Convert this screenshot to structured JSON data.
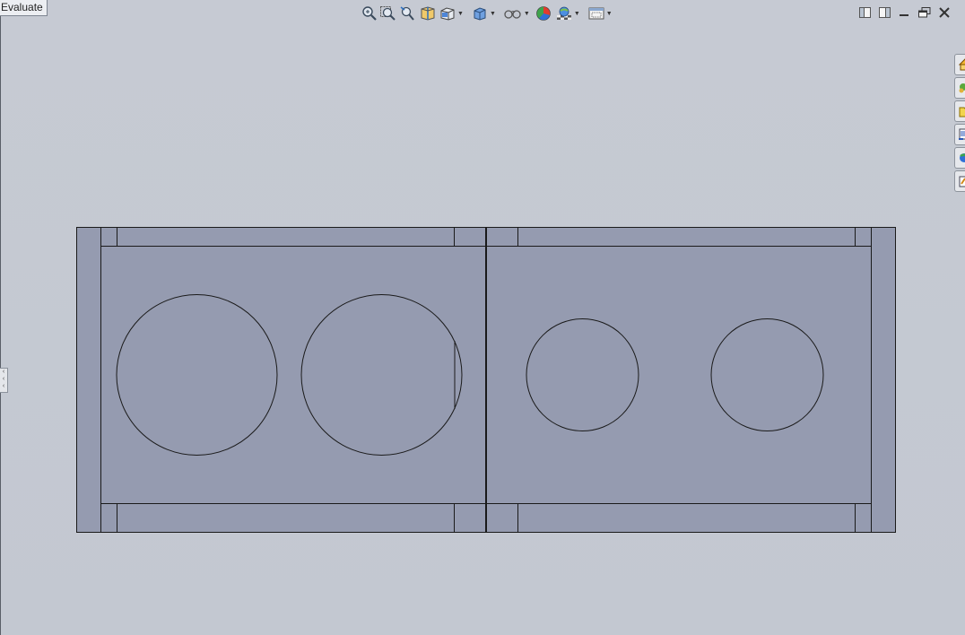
{
  "app": {
    "evaluate_tab_label": "Evaluate"
  },
  "heads_up_toolbar": {
    "items": [
      "zoom-to-fit-icon",
      "zoom-to-area-icon",
      "previous-view-icon",
      "section-view-icon",
      "view-orientation-icon",
      "display-style-icon",
      "hide-show-items-icon",
      "edit-appearance-icon",
      "apply-scene-icon",
      "view-settings-icon"
    ]
  },
  "window_controls": [
    "tile-left-icon",
    "tile-right-icon",
    "minimize-icon",
    "restore-icon",
    "close-icon"
  ],
  "task_pane": {
    "tabs": [
      "solidworks-resources-icon",
      "design-library-icon",
      "file-explorer-icon",
      "view-palette-icon",
      "appearances-scenes-icon",
      "custom-properties-icon"
    ]
  },
  "colors": {
    "viewport_background": "#c5c9d2",
    "part_face": "#959bb0",
    "part_edge": "#1a1a1a"
  }
}
